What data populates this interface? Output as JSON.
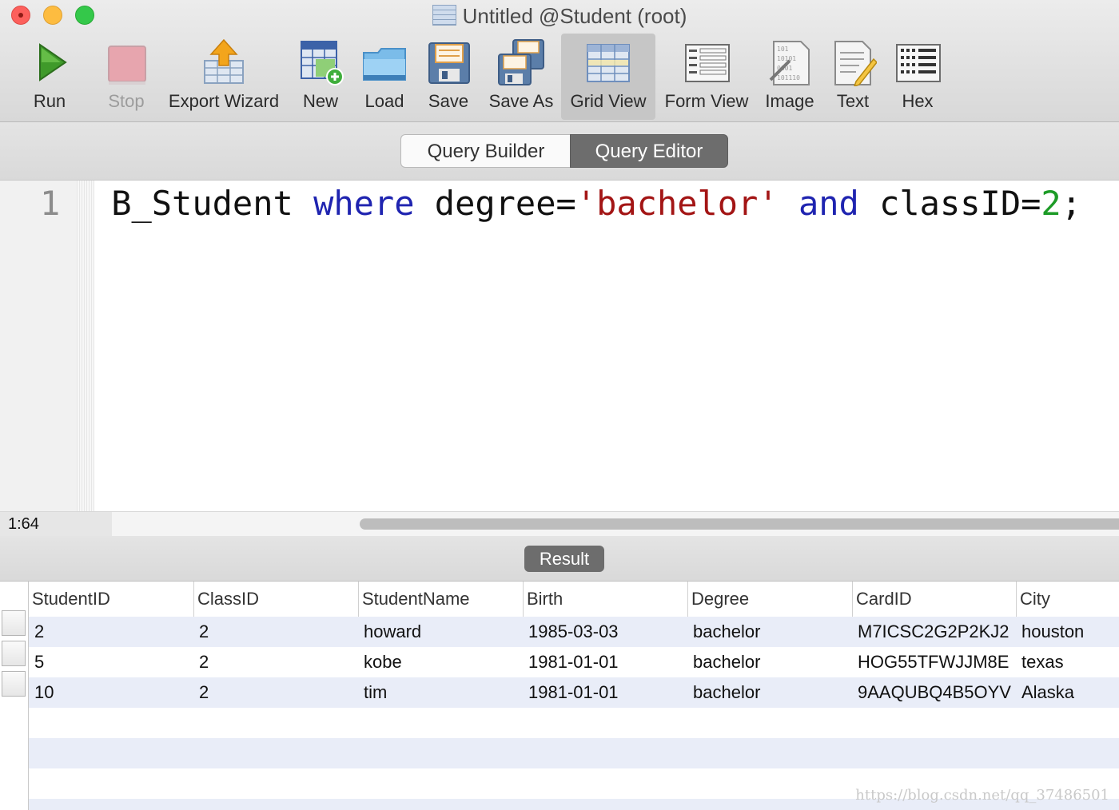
{
  "window": {
    "title": "Untitled @Student (root)"
  },
  "toolbar": [
    {
      "label": "Run",
      "icon": "run-icon"
    },
    {
      "label": "Stop",
      "icon": "stop-icon"
    },
    {
      "label": "Export Wizard",
      "icon": "export-wizard-icon"
    },
    {
      "label": "New",
      "icon": "new-icon"
    },
    {
      "label": "Load",
      "icon": "load-icon"
    },
    {
      "label": "Save",
      "icon": "save-icon"
    },
    {
      "label": "Save As",
      "icon": "save-as-icon"
    },
    {
      "label": "Grid View",
      "icon": "grid-view-icon"
    },
    {
      "label": "Form View",
      "icon": "form-view-icon"
    },
    {
      "label": "Image",
      "icon": "image-icon"
    },
    {
      "label": "Text",
      "icon": "text-icon"
    },
    {
      "label": "Hex",
      "icon": "hex-icon"
    }
  ],
  "segments": {
    "builder": "Query Builder",
    "editor": "Query Editor",
    "selected": "Query Editor"
  },
  "editor": {
    "line_number": "1",
    "code": {
      "t1": "B_Student ",
      "kw1": "where",
      "t2": " degree=",
      "s1": "'bachelor'",
      "t3": " ",
      "kw2": "and",
      "t4": " classID=",
      "n1": "2",
      "t5": ";"
    },
    "cursor_position": "1:64"
  },
  "result": {
    "label": "Result",
    "columns": [
      "StudentID",
      "ClassID",
      "StudentName",
      "Birth",
      "Degree",
      "CardID",
      "City"
    ],
    "rows": [
      [
        "2",
        "2",
        "howard",
        "1985-03-03",
        "bachelor",
        "M7ICSC2G2P2KJ2",
        "houston"
      ],
      [
        "5",
        "2",
        "kobe",
        "1981-01-01",
        "bachelor",
        "HOG55TFWJJM8E",
        "texas"
      ],
      [
        "10",
        "2",
        "tim",
        "1981-01-01",
        "bachelor",
        "9AAQUBQ4B5OYV",
        "Alaska"
      ]
    ]
  },
  "watermark": "https://blog.csdn.net/qq_37486501",
  "colors": {
    "keyword": "#1f24b0",
    "string": "#a31515",
    "number": "#1c9b26",
    "active_segment": "#6d6d6d",
    "row_stripe": "#e9edf8"
  }
}
